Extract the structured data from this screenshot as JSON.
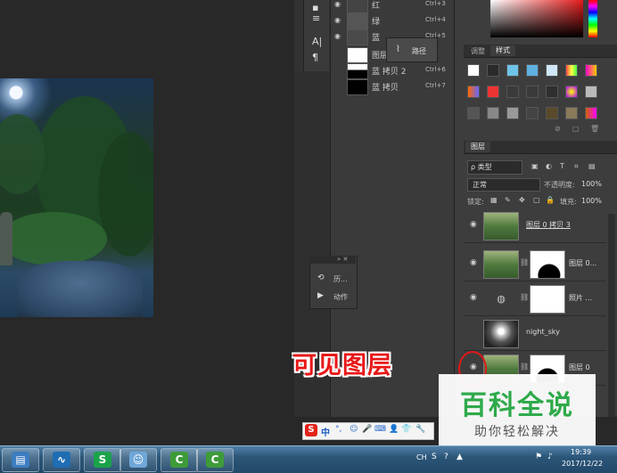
{
  "channels": {
    "rows": [
      {
        "name": "红",
        "shortcut": "Ctrl+3"
      },
      {
        "name": "绿",
        "shortcut": "Ctrl+4"
      },
      {
        "name": "蓝",
        "shortcut": "Ctrl+5"
      },
      {
        "name": "图层 0 …",
        "shortcut": ""
      },
      {
        "name": "蓝 拷贝 2",
        "shortcut": "Ctrl+6"
      },
      {
        "name": "蓝 拷贝",
        "shortcut": "Ctrl+7"
      }
    ],
    "popup_label": "路径"
  },
  "mini_panel": {
    "items": [
      {
        "icon": "history-icon",
        "label": "历..."
      },
      {
        "icon": "play-icon",
        "label": "动作"
      }
    ]
  },
  "tabs": {
    "adjust": "调整",
    "styles": "样式",
    "layers": "图层"
  },
  "layers_panel": {
    "filter_label": "ρ 类型",
    "blend_mode": "正常",
    "opacity_label": "不透明度:",
    "opacity_value": "100%",
    "lock_label": "锁定:",
    "fill_label": "填充:",
    "fill_value": "100%",
    "layers": [
      {
        "name": "图层 0 拷贝 3",
        "thumb": "forest",
        "has_mask": false
      },
      {
        "name": "图层 0...",
        "thumb": "forest",
        "has_mask": true
      },
      {
        "name": "照片 ...",
        "thumb": "adjust",
        "has_mask": true
      },
      {
        "name": "night_sky",
        "thumb": "dark",
        "has_mask": false
      },
      {
        "name": "图层 0",
        "thumb": "forest",
        "has_mask": true
      }
    ]
  },
  "annotation": {
    "label": "可见图层"
  },
  "watermark": {
    "title": "百科全说",
    "subtitle": "助你轻松解决"
  },
  "ime_bar": {
    "mode": "中"
  },
  "taskbar": {
    "tray_lang": "CH",
    "time": "19:39",
    "date": "2017/12/22"
  }
}
